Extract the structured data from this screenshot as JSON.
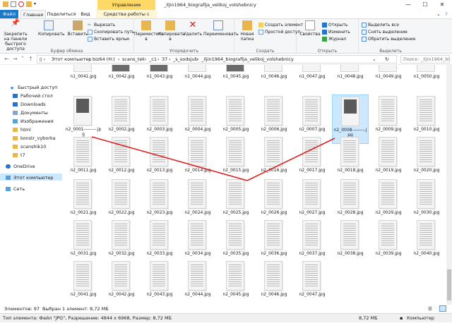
{
  "window": {
    "title": "_iljin1964_biografija_velikoj_volshebnicy",
    "context_tab_band": "Управление",
    "controls": {
      "minimize": "—",
      "maximize": "☐",
      "close": "✕"
    }
  },
  "tabs": [
    {
      "label": "Файл"
    },
    {
      "label": "Главная"
    },
    {
      "label": "Поделиться"
    },
    {
      "label": "Вид"
    },
    {
      "label": "Средства работы с рисунками"
    }
  ],
  "ribbon": {
    "clipboard": {
      "pin": "Закрепить на панели быстрого доступа",
      "copy": "Копировать",
      "paste": "Вставить",
      "cut": "Вырезать",
      "copy_path": "Скопировать путь",
      "paste_shortcut": "Вставить ярлык",
      "label": "Буфер обмена"
    },
    "organize": {
      "move": "Переместить в",
      "copy_to": "Копировать в",
      "delete": "Удалить",
      "rename": "Переименовать",
      "label": "Упорядочить"
    },
    "new": {
      "new_folder": "Новая папка",
      "new_item": "Создать элемент",
      "easy_access": "Простой доступ",
      "label": "Создать"
    },
    "open": {
      "properties": "Свойства",
      "open": "Открыть",
      "edit": "Изменить",
      "history": "Журнал",
      "label": "Открыть"
    },
    "select": {
      "select_all": "Выделить все",
      "select_none": "Снять выделение",
      "invert": "Обратить выделение",
      "label": "Выделить"
    }
  },
  "address": {
    "crumbs": [
      "Этот компьютер",
      "biz64 (H:)",
      "scans_tek",
      "_c1",
      "37",
      "_s_sodsjub",
      "_iljin1964_biografija_velikoj_volshebnicy"
    ],
    "search_placeholder": "Поиск: _iljin1964_biografija..."
  },
  "sidebar": {
    "items": [
      {
        "label": "Быстрый доступ",
        "icon": "star-icon"
      },
      {
        "label": "Рабочий стол",
        "icon": "desktop-icon"
      },
      {
        "label": "Downloads",
        "icon": "download-icon"
      },
      {
        "label": "Документы",
        "icon": "documents-icon"
      },
      {
        "label": "Изображения",
        "icon": "pictures-icon"
      },
      {
        "label": "html",
        "icon": "folder-icon"
      },
      {
        "label": "konstr_vyborka",
        "icon": "folder-icon"
      },
      {
        "label": "scanshik10",
        "icon": "folder-icon"
      },
      {
        "label": "t7",
        "icon": "folder-icon"
      },
      {
        "label": "OneDrive",
        "icon": "cloud-icon"
      },
      {
        "label": "Этот компьютер",
        "icon": "computer-icon"
      },
      {
        "label": "Сеть",
        "icon": "network-icon"
      }
    ]
  },
  "files": {
    "top_row": [
      "n1_0041.jpg",
      "n1_0042.jpg",
      "n1_0043.jpg",
      "n1_0044.jpg",
      "n1_0045.jpg",
      "n1_0046.jpg",
      "n1_0047.jpg",
      "n1_0048.jpg",
      "n1_0049.jpg",
      "n1_0050.jpg"
    ],
    "rows": [
      [
        "n2_0001--------.jpg",
        "n2_0002.jpg",
        "n2_0003.jpg",
        "n2_0004.jpg",
        "n2_0005.jpg",
        "n2_0006.jpg",
        "n2_0007.jpg",
        "n2_0008--------.jpg",
        "n2_0009.jpg",
        "n2_0010.jpg"
      ],
      [
        "n2_0011.jpg",
        "n2_0012.jpg",
        "n2_0013.jpg",
        "n2_0014.jpg",
        "n2_0015.jpg",
        "n2_0016.jpg",
        "n2_0017.jpg",
        "n2_0018.jpg",
        "n2_0019.jpg",
        "n2_0020.jpg"
      ],
      [
        "n2_0021.jpg",
        "n2_0022.jpg",
        "n2_0023.jpg",
        "n2_0024.jpg",
        "n2_0025.jpg",
        "n2_0026.jpg",
        "n2_0027.jpg",
        "n2_0028.jpg",
        "n2_0029.jpg",
        "n2_0030.jpg"
      ],
      [
        "n2_0031.jpg",
        "n2_0032.jpg",
        "n2_0033.jpg",
        "n2_0034.jpg",
        "n2_0035.jpg",
        "n2_0036.jpg",
        "n2_0037.jpg",
        "n2_0038.jpg",
        "n2_0039.jpg",
        "n2_0040.jpg"
      ],
      [
        "n2_0041.jpg",
        "n2_0042.jpg",
        "n2_0043.jpg",
        "n2_0044.jpg",
        "n2_0045.jpg",
        "n2_0046.jpg",
        "n2_0047.jpg"
      ]
    ],
    "selected": "n2_0008--------.jpg"
  },
  "status": {
    "count": "Элементов: 97",
    "selected": "Выбран 1 элемент: 8,72 МБ",
    "info": "Тип элемента: Файл \"JPG\", Разрешение: 4844 x 6968, Размер: 8,72 МБ",
    "size": "8,72 МБ",
    "location": "Компьютер"
  },
  "colors": {
    "accent": "#1979ca",
    "selection": "#cce8ff",
    "annotation": "#e02020",
    "context_band": "#ffd966"
  }
}
